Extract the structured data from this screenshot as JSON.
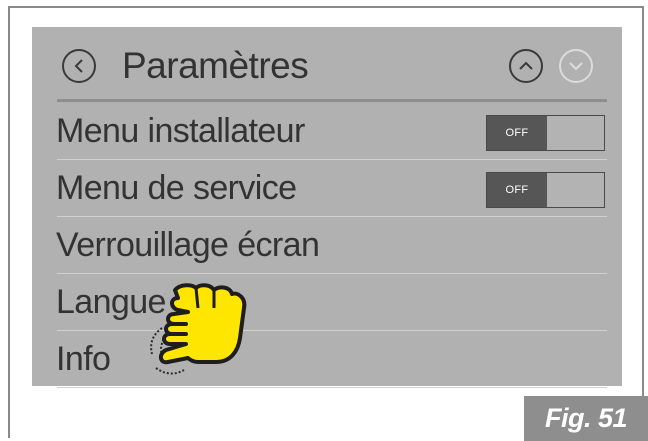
{
  "header": {
    "title": "Paramètres",
    "back_icon": "chevron-left-icon",
    "up_icon": "chevron-up-icon",
    "down_icon": "chevron-down-icon"
  },
  "menu": {
    "items": [
      {
        "label": "Menu installateur",
        "toggle": "OFF"
      },
      {
        "label": "Menu de service",
        "toggle": "OFF"
      },
      {
        "label": "Verrouillage écran"
      },
      {
        "label": "Langue"
      },
      {
        "label": "Info"
      }
    ]
  },
  "overlay": {
    "icon": "hand-swipe-up-icon",
    "color": "#ffe600"
  },
  "figure": {
    "label": "Fig. 51"
  },
  "colors": {
    "screen_bg": "#b1b1b1",
    "text": "#333333",
    "toggle_off": "#565656"
  }
}
